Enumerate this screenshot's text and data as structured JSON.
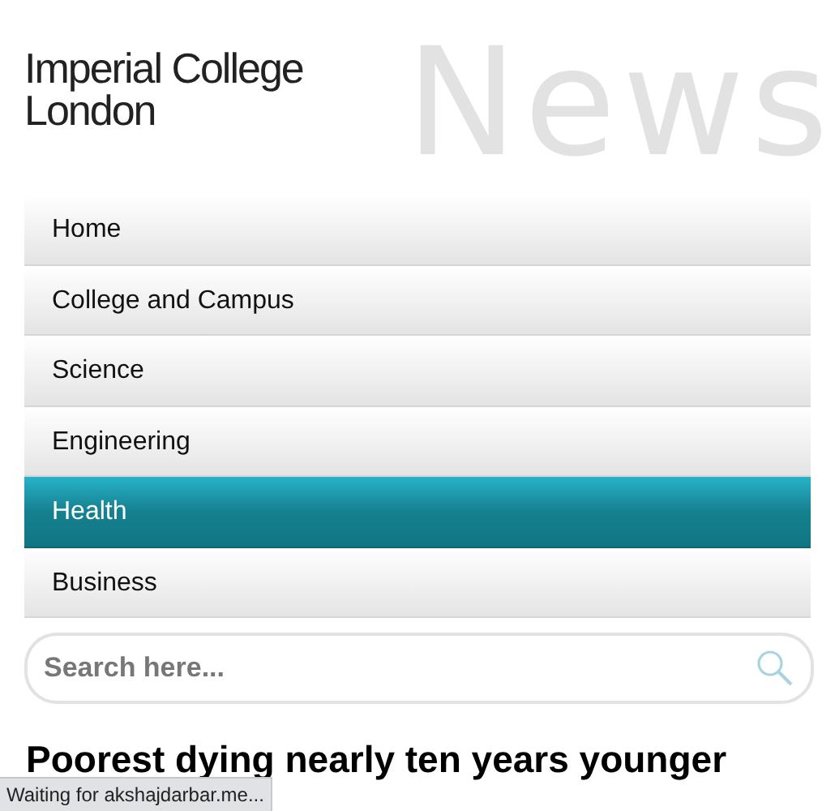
{
  "logo": {
    "lines": [
      "Imperial College",
      "London"
    ]
  },
  "section_title": "News",
  "nav": [
    {
      "label": "Home",
      "selected": false
    },
    {
      "label": "College and Campus",
      "selected": false
    },
    {
      "label": "Science",
      "selected": false
    },
    {
      "label": "Engineering",
      "selected": false
    },
    {
      "label": "Health",
      "selected": true
    },
    {
      "label": "Business",
      "selected": false
    }
  ],
  "search": {
    "placeholder": "Search here..."
  },
  "headline": {
    "lines": [
      "Poorest dying nearly ten years younger"
    ]
  },
  "status_bar": "Waiting for akshajdarbar.me..."
}
